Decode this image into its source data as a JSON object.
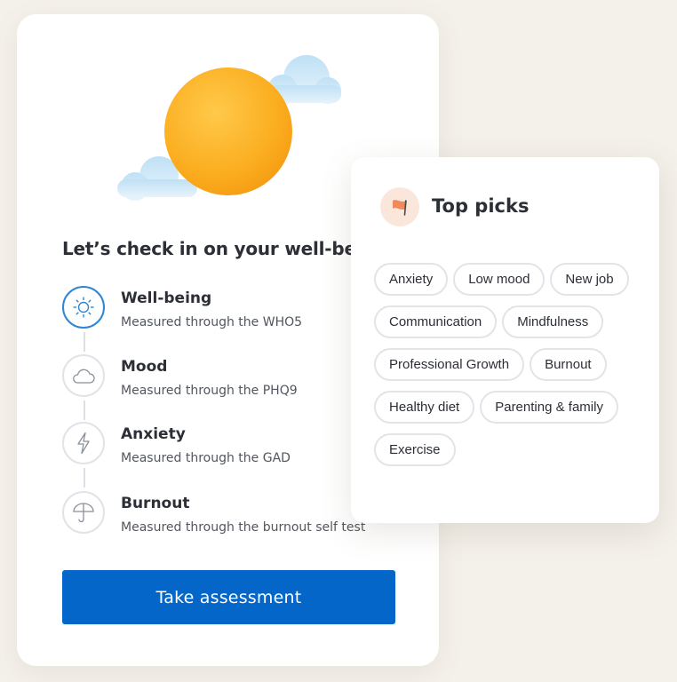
{
  "checkin": {
    "heading": "Let’s check in on your well-bein",
    "items": [
      {
        "title": "Well-being",
        "subtitle": "Measured through the WHO5",
        "icon": "sun-icon"
      },
      {
        "title": "Mood",
        "subtitle": "Measured through the PHQ9",
        "icon": "cloud-icon"
      },
      {
        "title": "Anxiety",
        "subtitle": "Measured through the GAD",
        "icon": "lightning-icon"
      },
      {
        "title": "Burnout",
        "subtitle": "Measured through the burnout self test",
        "icon": "umbrella-icon"
      }
    ],
    "cta_label": "Take assessment"
  },
  "top_picks": {
    "title": "Top picks",
    "icon": "flag-icon",
    "chips": [
      [
        "Anxiety",
        "Low mood",
        "New job"
      ],
      [
        "Communication",
        "Mindfulness"
      ],
      [
        "Professional Growth",
        "Burnout"
      ],
      [
        "Healthy diet",
        "Parenting & family"
      ],
      [
        "Exercise"
      ]
    ]
  },
  "colors": {
    "primary": "#0466c8",
    "active_ring": "#2f86d4",
    "sun": "#f9a825",
    "background": "#f4f1ea",
    "flag": "#f08a5d"
  }
}
